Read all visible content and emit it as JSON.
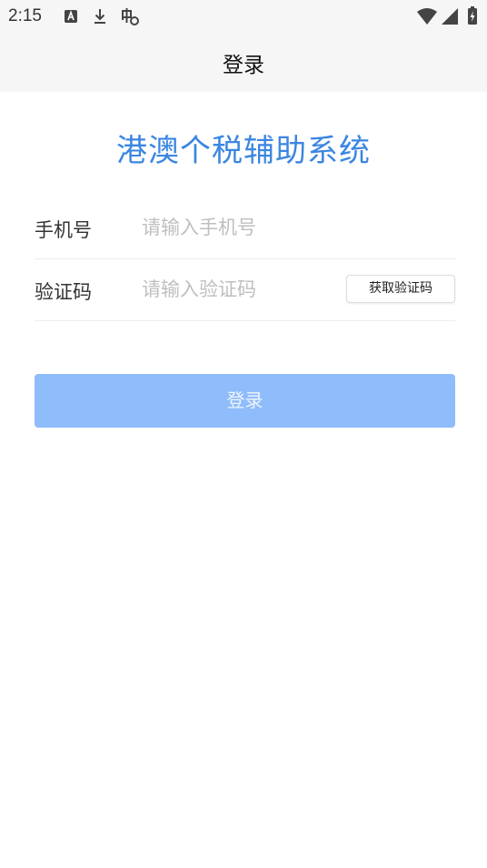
{
  "status_bar": {
    "time": "2:15",
    "icons": [
      "notification-a-icon",
      "download-icon",
      "bug-icon",
      "wifi-icon",
      "cell-signal-icon",
      "battery-charging-icon"
    ]
  },
  "app_bar": {
    "title": "登录"
  },
  "main": {
    "system_title": "港澳个税辅助系统",
    "phone": {
      "label": "手机号",
      "placeholder": "请输入手机号",
      "value": ""
    },
    "code": {
      "label": "验证码",
      "placeholder": "请输入验证码",
      "value": "",
      "get_code_label": "获取验证码"
    },
    "login_label": "登录"
  },
  "colors": {
    "accent": "#3b86e0",
    "login_button": "#8fbcfb",
    "placeholder": "#bfbfbf"
  }
}
